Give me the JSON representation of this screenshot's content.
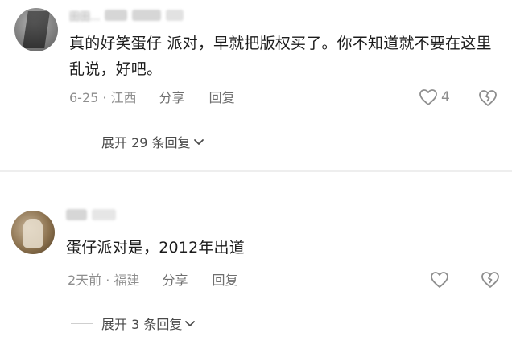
{
  "comments": [
    {
      "username": "田田...",
      "text": "真的好笑蛋仔 派对，早就把版权买了。你不知道就不要在这里乱说，好吧。",
      "date_location": "6-25 · 江西",
      "share_label": "分享",
      "reply_label": "回复",
      "like_count": "4",
      "expand_label": "展开 29 条回复"
    },
    {
      "username": "",
      "text": "蛋仔派对是，2012年出道",
      "date_location": "2天前 · 福建",
      "share_label": "分享",
      "reply_label": "回复",
      "like_count": "",
      "expand_label": "展开 3 条回复"
    }
  ],
  "icons": {
    "like": "heart-outline-icon",
    "dislike": "broken-heart-icon",
    "expand": "chevron-down-icon"
  },
  "colors": {
    "text": "#1c1c1c",
    "meta": "#8e8e8e",
    "divider": "#eeeeee"
  }
}
